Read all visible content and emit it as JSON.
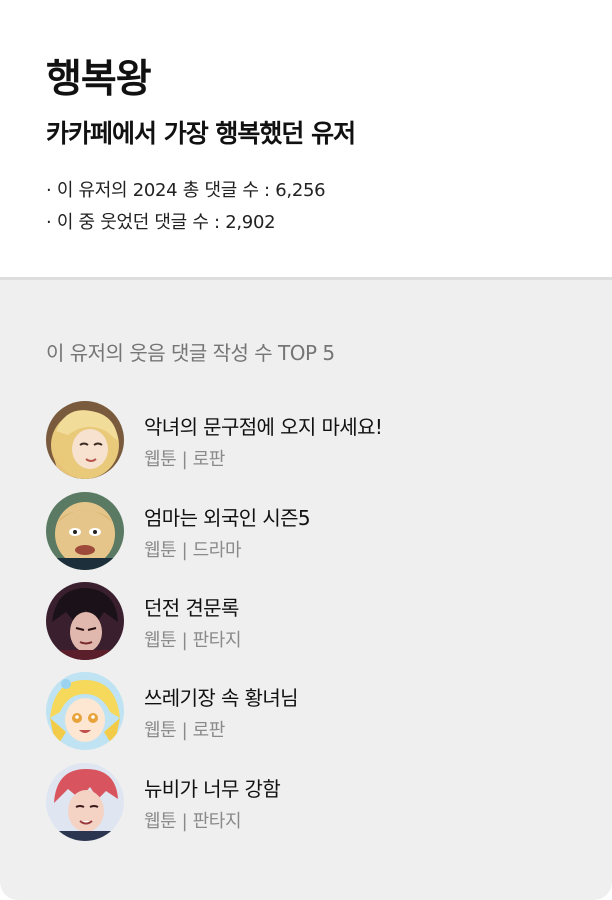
{
  "header": {
    "title": "행복왕",
    "subtitle": "카카페에서 가장 행복했던 유저",
    "stats": [
      "· 이 유저의 2024 총 댓글 수 : 6,256",
      "· 이 중 웃었던 댓글 수 : 2,902"
    ]
  },
  "top5": {
    "section_title": "이 유저의 웃음 댓글 작성 수 TOP 5",
    "items": [
      {
        "title": "악녀의 문구점에 오지 마세요!",
        "meta": "웹툰 | 로판",
        "avatar": "blonde-woman-avatar"
      },
      {
        "title": "엄마는 외국인 시즌5",
        "meta": "웹툰 | 드라마",
        "avatar": "bald-man-avatar"
      },
      {
        "title": "던전 견문록",
        "meta": "웹툰 | 판타지",
        "avatar": "dark-hair-man-avatar"
      },
      {
        "title": "쓰레기장 속 황녀님",
        "meta": "웹툰 | 로판",
        "avatar": "blonde-girl-avatar"
      },
      {
        "title": "뉴비가 너무 강함",
        "meta": "웹툰 | 판타지",
        "avatar": "red-hair-boy-avatar"
      }
    ]
  },
  "colors": {
    "background_top": "#ffffff",
    "background_bottom": "#efefef",
    "divider": "#dedede",
    "text_primary": "#111111",
    "text_secondary": "#757575",
    "text_meta": "#8a8a8a"
  }
}
